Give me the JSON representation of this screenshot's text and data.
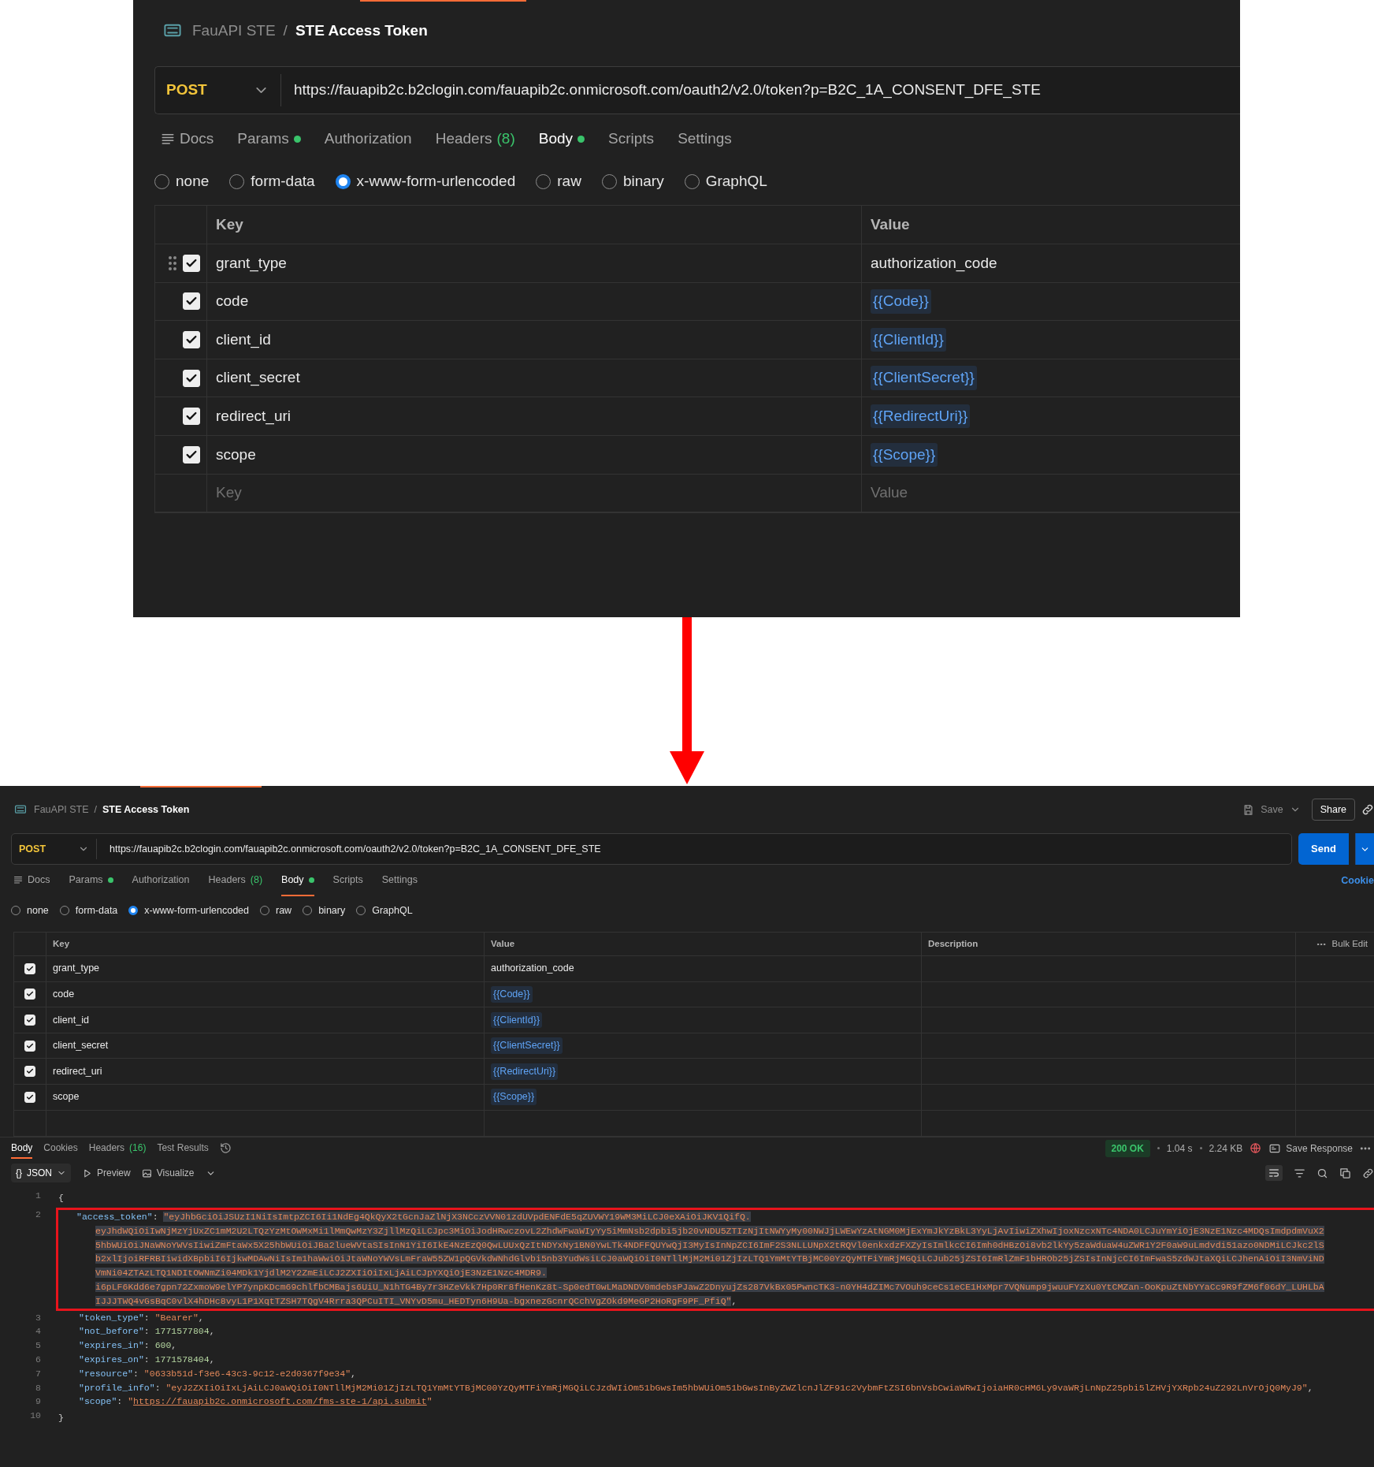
{
  "top_view": {
    "breadcrumb": {
      "collection": "FauAPI STE",
      "separator": "/",
      "request": "STE Access Token"
    },
    "request_bar": {
      "method": "POST",
      "url": "https://fauapib2c.b2clogin.com/fauapib2c.onmicrosoft.com/oauth2/v2.0/token?p=B2C_1A_CONSENT_DFE_STE"
    },
    "tabs": [
      {
        "label": "Docs",
        "kind": "docs",
        "status_dot": false,
        "selected": false
      },
      {
        "label": "Params",
        "kind": "plain",
        "status_dot": true,
        "selected": false
      },
      {
        "label": "Authorization",
        "kind": "plain",
        "status_dot": false,
        "selected": false
      },
      {
        "label": "Headers",
        "count": "(8)",
        "kind": "plain",
        "status_dot": false,
        "selected": false
      },
      {
        "label": "Body",
        "kind": "plain",
        "status_dot": true,
        "selected": true
      },
      {
        "label": "Scripts",
        "kind": "plain",
        "status_dot": false,
        "selected": false
      },
      {
        "label": "Settings",
        "kind": "plain",
        "status_dot": false,
        "selected": false
      }
    ],
    "body_types": [
      {
        "label": "none",
        "selected": false
      },
      {
        "label": "form-data",
        "selected": false
      },
      {
        "label": "x-www-form-urlencoded",
        "selected": true
      },
      {
        "label": "raw",
        "selected": false
      },
      {
        "label": "binary",
        "selected": false
      },
      {
        "label": "GraphQL",
        "selected": false
      }
    ],
    "params_table": {
      "columns": [
        "Key",
        "Value"
      ],
      "rows": [
        {
          "key": "grant_type",
          "value": "authorization_code",
          "kind": "text",
          "checked": true,
          "hovered": true
        },
        {
          "key": "code",
          "value": "{{Code}}",
          "kind": "variable",
          "checked": true,
          "hovered": false
        },
        {
          "key": "client_id",
          "value": "{{ClientId}}",
          "kind": "variable",
          "checked": true,
          "hovered": false
        },
        {
          "key": "client_secret",
          "value": "{{ClientSecret}}",
          "kind": "variable",
          "checked": true,
          "hovered": false
        },
        {
          "key": "redirect_uri",
          "value": "{{RedirectUri}}",
          "kind": "variable",
          "checked": true,
          "hovered": false
        },
        {
          "key": "scope",
          "value": "{{Scope}}",
          "kind": "variable",
          "checked": true,
          "hovered": false
        }
      ],
      "placeholder_row": {
        "key_field": {
          "placeholder": "Key"
        },
        "value_field": {
          "placeholder": "Value"
        }
      }
    }
  },
  "full_view": {
    "breadcrumb": {
      "collection": "FauAPI STE",
      "separator": "/",
      "request": "STE Access Token"
    },
    "actions": {
      "save": "Save",
      "share": "Share"
    },
    "request_bar": {
      "method": "POST",
      "url": "https://fauapib2c.b2clogin.com/fauapib2c.onmicrosoft.com/oauth2/v2.0/token?p=B2C_1A_CONSENT_DFE_STE",
      "send": "Send"
    },
    "tabs": [
      {
        "label": "Docs",
        "kind": "docs",
        "status_dot": false,
        "selected": false
      },
      {
        "label": "Params",
        "kind": "plain",
        "status_dot": true,
        "selected": false
      },
      {
        "label": "Authorization",
        "kind": "plain",
        "status_dot": false,
        "selected": false
      },
      {
        "label": "Headers",
        "count": "(8)",
        "kind": "plain",
        "status_dot": false,
        "selected": false
      },
      {
        "label": "Body",
        "kind": "plain",
        "status_dot": true,
        "selected": true
      },
      {
        "label": "Scripts",
        "kind": "plain",
        "status_dot": false,
        "selected": false
      },
      {
        "label": "Settings",
        "kind": "plain",
        "status_dot": false,
        "selected": false
      }
    ],
    "cookies_link": "Cookie",
    "body_types": [
      {
        "label": "none",
        "selected": false
      },
      {
        "label": "form-data",
        "selected": false
      },
      {
        "label": "x-www-form-urlencoded",
        "selected": true
      },
      {
        "label": "raw",
        "selected": false
      },
      {
        "label": "binary",
        "selected": false
      },
      {
        "label": "GraphQL",
        "selected": false
      }
    ],
    "params_table": {
      "columns": [
        "Key",
        "Value",
        "Description"
      ],
      "bulk_edit": "Bulk Edit",
      "rows": [
        {
          "key": "grant_type",
          "value": "authorization_code",
          "kind": "text",
          "checked": true,
          "hovered": false
        },
        {
          "key": "code",
          "value": "{{Code}}",
          "kind": "variable",
          "checked": true,
          "hovered": false
        },
        {
          "key": "client_id",
          "value": "{{ClientId}}",
          "kind": "variable",
          "checked": true,
          "hovered": false
        },
        {
          "key": "client_secret",
          "value": "{{ClientSecret}}",
          "kind": "variable",
          "checked": true,
          "hovered": false
        },
        {
          "key": "redirect_uri",
          "value": "{{RedirectUri}}",
          "kind": "variable",
          "checked": true,
          "hovered": false
        },
        {
          "key": "scope",
          "value": "{{Scope}}",
          "kind": "variable",
          "checked": true,
          "hovered": false
        }
      ]
    },
    "response": {
      "tabs": [
        {
          "label": "Body",
          "selected": true
        },
        {
          "label": "Cookies",
          "selected": false
        },
        {
          "label": "Headers",
          "count": "(16)",
          "selected": false
        },
        {
          "label": "Test Results",
          "selected": false
        }
      ],
      "status": "200 OK",
      "time": "1.04 s",
      "size": "2.24 KB",
      "save_response": "Save Response",
      "format": {
        "glyph": "{}",
        "label": "JSON"
      },
      "view_modes": [
        "Preview",
        "Visualize"
      ],
      "lines": [
        {
          "number": "1",
          "kind": "punct",
          "text": "{",
          "selected": false,
          "annotated": false
        },
        {
          "number": "2",
          "kind": "string",
          "key": "\"access_token\"",
          "sep": ": ",
          "value_parts": [
            "\"eyJhbGciOiJSUzI1NiIsImtpZCI6Ii1NdEg4QkQyX2tGcnJaZlNjX3NCczVVN01zdUVpdENFdE5qZUVWY19WM3MiLCJ0eXAiOiJKV1QifQ.",
            "eyJhdWQiOiIwNjMzYjUxZC1mM2U2LTQzYzMtOWMxMi1lMmQwMzY3ZjllMzQiLCJpc3MiOiJodHRwczovL2ZhdWFwaWIyYy5iMmNsb2dpbi5jb20vNDU5ZTIzNjItNWYyMy00NWJjLWEwYzAtNGM0MjExYmJkYzBkL3YyLjAvIiwiZXhwIjoxNzcxNTc4NDA0LCJuYmYiOjE3NzE1Nzc4MDQsImdpdmVuX2",
            "5hbWUiOiJNaWNoYWVsIiwiZmFtaWx5X25hbWUiOiJBa2lueWVtaSIsInN1YiI6IkE4NzEzQ0QwLUUxQzItNDYxNy1BN0YwLTk4NDFFQUYwQjI3MyIsInNpZCI6ImF2S3NLLUNpX2tRQVl0enkxdzFXZyIsImlkcCI6Imh0dHBzOi8vb2lkYy5zaWduaW4uZWR1Y2F0aW9uLmdvdi51azo0NDMiLCJkc2lS",
            "b2xlIjoiRFRBIiwidXBpbiI6IjkwMDAwNiIsIm1haWwiOiJtaWNoYWVsLmFraW55ZW1pQGVkdWNhdGlvbi5nb3YudWsiLCJ0aWQiOiI0NTllMjM2Mi01ZjIzLTQ1YmMtYTBjMC00YzQyMTFiYmRjMGQiLCJub25jZSI6ImRlZmF1bHROb25jZSIsInNjcCI6ImFwaS5zdWJtaXQiLCJhenAiOiI3NmViND",
            "VmNi04ZTAzLTQ1NDItOWNmZi04MDk1YjdlM2Y2ZmEiLCJ2ZXIiOiIxLjAiLCJpYXQiOjE3NzE1Nzc4MDR9.",
            "i6pLF6Kdd6e7gpn72ZxmoW9elYP7ynpKDcm69chlfbCMBajs6UiU_N1hTG4By7r3HZeVkk7Hp0Rr8fHenKz8t-Sp0edT0wLMaDNDV0mdebsPJawZ2DnyujZs287VkBx05PwncTK3-n0YH4dZIMc7VOuh9ceCs1eCE1HxMpr7VQNump9jwuuFYzXu0YtCMZan-OoKpuZtNbYYaCc9R9fZM6f06dY_LUHLbA",
            "IJJJTWQ4vGsBqC0vlX4hDHc8vyL1P1XqtTZSH7TQgV4Rrra3QPCuITI_VNYvD5mu_HEDTyn6H9Ua-bgxnezGcnrQCchVgZOkd9MeGP2HoRgF9PF_PfiQ\""
          ],
          "end": ",",
          "selected": true,
          "annotated": true
        },
        {
          "number": "3",
          "kind": "string",
          "key": "\"token_type\"",
          "sep": ": ",
          "value": "\"Bearer\"",
          "end": ",",
          "selected": false,
          "annotated": false
        },
        {
          "number": "4",
          "kind": "number",
          "key": "\"not_before\"",
          "sep": ": ",
          "value": "1771577804",
          "end": ",",
          "selected": false,
          "annotated": false
        },
        {
          "number": "5",
          "kind": "number",
          "key": "\"expires_in\"",
          "sep": ": ",
          "value": "600",
          "end": ",",
          "selected": false,
          "annotated": false
        },
        {
          "number": "6",
          "kind": "number",
          "key": "\"expires_on\"",
          "sep": ": ",
          "value": "1771578404",
          "end": ",",
          "selected": false,
          "annotated": false
        },
        {
          "number": "7",
          "kind": "string",
          "key": "\"resource\"",
          "sep": ": ",
          "value": "\"0633b51d-f3e6-43c3-9c12-e2d0367f9e34\"",
          "end": ",",
          "selected": false,
          "annotated": false
        },
        {
          "number": "8",
          "kind": "string",
          "key": "\"profile_info\"",
          "sep": ": ",
          "value": "\"eyJ2ZXIiOiIxLjAiLCJ0aWQiOiI0NTllMjM2Mi01ZjIzLTQ1YmMtYTBjMC00YzQyMTFiYmRjMGQiLCJzdWIiOm51bGwsIm5hbWUiOm51bGwsInByZWZlcnJlZF91c2VybmFtZSI6bnVsbCwiaWRwIjoiaHR0cHM6Ly9vaWRjLnNpZ25pbi5lZHVjYXRpb24uZ292LnVrOjQ0MyJ9\"",
          "end": ",",
          "selected": false,
          "annotated": false
        },
        {
          "number": "9",
          "kind": "link",
          "key": "\"scope\"",
          "sep": ": ",
          "quote": "\"",
          "value": "https://fauapib2c.onmicrosoft.com/fms-ste-1/api.submit",
          "selected": false,
          "annotated": false
        },
        {
          "number": "10",
          "kind": "punct",
          "text": "}",
          "selected": false,
          "annotated": false
        }
      ]
    }
  }
}
